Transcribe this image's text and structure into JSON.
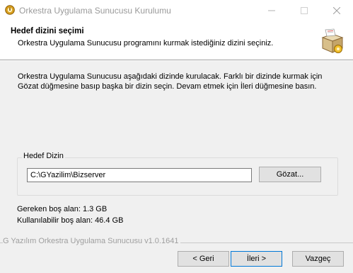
{
  "window": {
    "title": "Orkestra Uygulama Sunucusu Kurulumu",
    "icon": "installer-app-icon",
    "controls": [
      "minimize-icon",
      "maximize-icon",
      "close-icon"
    ]
  },
  "header": {
    "title": "Hedef dizini seçimi",
    "subtitle": "Orkestra Uygulama Sunucusu programını kurmak istediğiniz dizini seçiniz.",
    "icon": "installer-box-icon"
  },
  "body": {
    "description": "Orkestra Uygulama Sunucusu aşağıdaki dizinde kurulacak. Farklı bir dizinde kurmak için Gözat düğmesine basıp başka bir dizin seçin. Devam etmek için İleri düğmesine basın.",
    "destination": {
      "label": "Hedef Dizin",
      "path": "C:\\GYazilim\\Bizserver",
      "browse_label": "Gözat..."
    },
    "space_required": "Gereken boş alan: 1.3 GB",
    "space_available": "Kullanılabilir boş alan: 46.4 GB"
  },
  "footer": {
    "branding": "G Yazılım Orkestra Uygulama Sunucusu v1.0.1641",
    "back_label": "< Geri",
    "next_label": "İleri >",
    "cancel_label": "Vazgeç"
  },
  "colors": {
    "window_bg": "#f0f0f0",
    "header_bg": "#ffffff",
    "button_bg": "#e1e1e1",
    "focus_border": "#0078d7"
  }
}
